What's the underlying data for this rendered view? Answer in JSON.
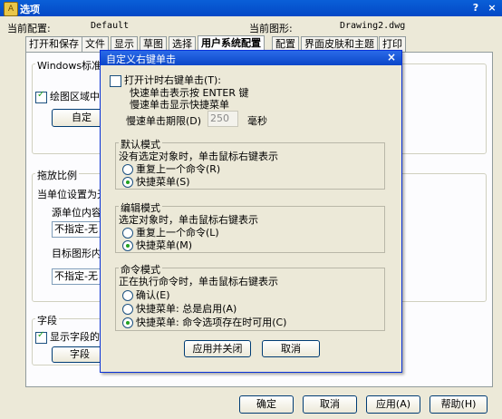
{
  "window": {
    "title": "选项",
    "help_label": "?",
    "close_label": "×"
  },
  "profile": {
    "current_profile_label": "当前配置:",
    "current_profile_value": "Default",
    "current_drawing_label": "当前图形:",
    "current_drawing_value": "Drawing2.dwg"
  },
  "tabs": [
    {
      "label": "打开和保存"
    },
    {
      "label": "文件"
    },
    {
      "label": "显示"
    },
    {
      "label": "草图"
    },
    {
      "label": "选择"
    },
    {
      "label": "用户系统配置",
      "active": true
    },
    {
      "label": "配置"
    },
    {
      "label": "界面皮肤和主题"
    },
    {
      "label": "打印"
    }
  ],
  "background_panel": {
    "windows_std_title": "Windows标准",
    "shortcut_menu_label": "绘图区域中使",
    "customize_button": "自定",
    "drag_scale_title": "拖放比例",
    "units_label": "当单位设置为无",
    "source_label": "源单位内容",
    "source_value": "不指定-无",
    "target_label": "目标图形内",
    "target_value": "不指定-无",
    "field_title": "字段",
    "show_field_label": "显示字段的背",
    "field_button": "字段"
  },
  "dialog": {
    "title": "自定义右键单击",
    "close_label": "×",
    "timer_checkbox": "打开计时右键单击(T):",
    "quick_click": "快速单击表示按 ENTER 键",
    "slow_click": "慢速单击显示快捷菜单",
    "delay_label": "慢速单击期限(D)",
    "delay_value": "250",
    "delay_unit": "毫秒",
    "default_mode": {
      "title": "默认模式",
      "desc": "没有选定对象时，单击鼠标右键表示",
      "options": [
        {
          "label": "重复上一个命令(R)",
          "selected": false
        },
        {
          "label": "快捷菜单(S)",
          "selected": true
        }
      ]
    },
    "edit_mode": {
      "title": "编辑模式",
      "desc": "选定对象时，单击鼠标右键表示",
      "options": [
        {
          "label": "重复上一个命令(L)",
          "selected": false
        },
        {
          "label": "快捷菜单(M)",
          "selected": true
        }
      ]
    },
    "command_mode": {
      "title": "命令模式",
      "desc": "正在执行命令时，单击鼠标右键表示",
      "options": [
        {
          "label": "确认(E)",
          "selected": false
        },
        {
          "label": "快捷菜单: 总是启用(A)",
          "selected": false
        },
        {
          "label": "快捷菜单: 命令选项存在时可用(C)",
          "selected": true
        }
      ]
    },
    "apply_close_button": "应用并关闭",
    "cancel_button": "取消"
  },
  "footer": {
    "ok_button": "确定",
    "cancel_button": "取消",
    "apply_button": "应用(A)",
    "help_button": "帮助(H)"
  }
}
